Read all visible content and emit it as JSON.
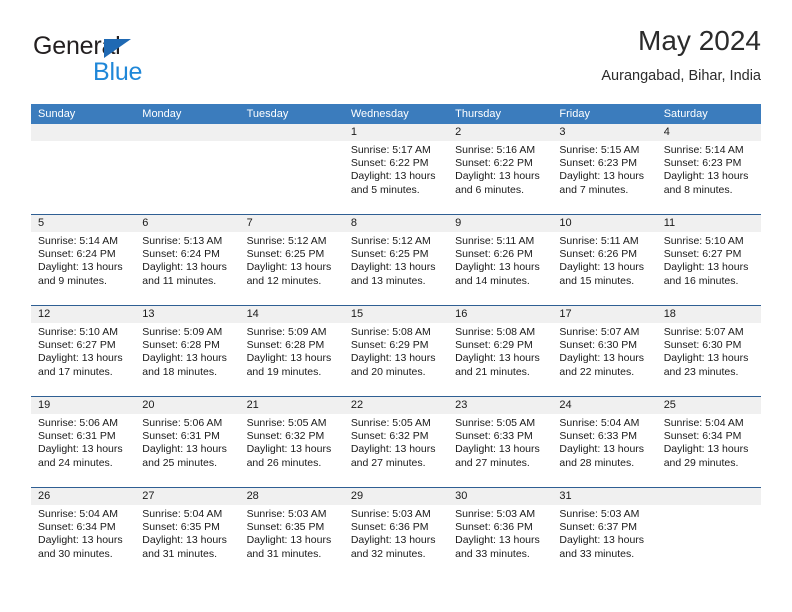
{
  "brand": {
    "line1": "General",
    "line2": "Blue",
    "triangle_color": "#1f69b3",
    "line2_color": "#1f87d8"
  },
  "header": {
    "title": "May 2024",
    "subtitle": "Aurangabad, Bihar, India"
  },
  "theme": {
    "header_bg": "#3b7cbd",
    "header_text": "#ffffff",
    "date_band_bg": "#f0f0f0",
    "week_rule": "#2f5f93"
  },
  "calendar": {
    "day_headers": [
      "Sunday",
      "Monday",
      "Tuesday",
      "Wednesday",
      "Thursday",
      "Friday",
      "Saturday"
    ],
    "weeks": [
      [
        {
          "date": "",
          "sunrise": "",
          "sunset": "",
          "daylight_line1": "",
          "daylight_line2": ""
        },
        {
          "date": "",
          "sunrise": "",
          "sunset": "",
          "daylight_line1": "",
          "daylight_line2": ""
        },
        {
          "date": "",
          "sunrise": "",
          "sunset": "",
          "daylight_line1": "",
          "daylight_line2": ""
        },
        {
          "date": "1",
          "sunrise": "Sunrise: 5:17 AM",
          "sunset": "Sunset: 6:22 PM",
          "daylight_line1": "Daylight: 13 hours",
          "daylight_line2": "and 5 minutes."
        },
        {
          "date": "2",
          "sunrise": "Sunrise: 5:16 AM",
          "sunset": "Sunset: 6:22 PM",
          "daylight_line1": "Daylight: 13 hours",
          "daylight_line2": "and 6 minutes."
        },
        {
          "date": "3",
          "sunrise": "Sunrise: 5:15 AM",
          "sunset": "Sunset: 6:23 PM",
          "daylight_line1": "Daylight: 13 hours",
          "daylight_line2": "and 7 minutes."
        },
        {
          "date": "4",
          "sunrise": "Sunrise: 5:14 AM",
          "sunset": "Sunset: 6:23 PM",
          "daylight_line1": "Daylight: 13 hours",
          "daylight_line2": "and 8 minutes."
        }
      ],
      [
        {
          "date": "5",
          "sunrise": "Sunrise: 5:14 AM",
          "sunset": "Sunset: 6:24 PM",
          "daylight_line1": "Daylight: 13 hours",
          "daylight_line2": "and 9 minutes."
        },
        {
          "date": "6",
          "sunrise": "Sunrise: 5:13 AM",
          "sunset": "Sunset: 6:24 PM",
          "daylight_line1": "Daylight: 13 hours",
          "daylight_line2": "and 11 minutes."
        },
        {
          "date": "7",
          "sunrise": "Sunrise: 5:12 AM",
          "sunset": "Sunset: 6:25 PM",
          "daylight_line1": "Daylight: 13 hours",
          "daylight_line2": "and 12 minutes."
        },
        {
          "date": "8",
          "sunrise": "Sunrise: 5:12 AM",
          "sunset": "Sunset: 6:25 PM",
          "daylight_line1": "Daylight: 13 hours",
          "daylight_line2": "and 13 minutes."
        },
        {
          "date": "9",
          "sunrise": "Sunrise: 5:11 AM",
          "sunset": "Sunset: 6:26 PM",
          "daylight_line1": "Daylight: 13 hours",
          "daylight_line2": "and 14 minutes."
        },
        {
          "date": "10",
          "sunrise": "Sunrise: 5:11 AM",
          "sunset": "Sunset: 6:26 PM",
          "daylight_line1": "Daylight: 13 hours",
          "daylight_line2": "and 15 minutes."
        },
        {
          "date": "11",
          "sunrise": "Sunrise: 5:10 AM",
          "sunset": "Sunset: 6:27 PM",
          "daylight_line1": "Daylight: 13 hours",
          "daylight_line2": "and 16 minutes."
        }
      ],
      [
        {
          "date": "12",
          "sunrise": "Sunrise: 5:10 AM",
          "sunset": "Sunset: 6:27 PM",
          "daylight_line1": "Daylight: 13 hours",
          "daylight_line2": "and 17 minutes."
        },
        {
          "date": "13",
          "sunrise": "Sunrise: 5:09 AM",
          "sunset": "Sunset: 6:28 PM",
          "daylight_line1": "Daylight: 13 hours",
          "daylight_line2": "and 18 minutes."
        },
        {
          "date": "14",
          "sunrise": "Sunrise: 5:09 AM",
          "sunset": "Sunset: 6:28 PM",
          "daylight_line1": "Daylight: 13 hours",
          "daylight_line2": "and 19 minutes."
        },
        {
          "date": "15",
          "sunrise": "Sunrise: 5:08 AM",
          "sunset": "Sunset: 6:29 PM",
          "daylight_line1": "Daylight: 13 hours",
          "daylight_line2": "and 20 minutes."
        },
        {
          "date": "16",
          "sunrise": "Sunrise: 5:08 AM",
          "sunset": "Sunset: 6:29 PM",
          "daylight_line1": "Daylight: 13 hours",
          "daylight_line2": "and 21 minutes."
        },
        {
          "date": "17",
          "sunrise": "Sunrise: 5:07 AM",
          "sunset": "Sunset: 6:30 PM",
          "daylight_line1": "Daylight: 13 hours",
          "daylight_line2": "and 22 minutes."
        },
        {
          "date": "18",
          "sunrise": "Sunrise: 5:07 AM",
          "sunset": "Sunset: 6:30 PM",
          "daylight_line1": "Daylight: 13 hours",
          "daylight_line2": "and 23 minutes."
        }
      ],
      [
        {
          "date": "19",
          "sunrise": "Sunrise: 5:06 AM",
          "sunset": "Sunset: 6:31 PM",
          "daylight_line1": "Daylight: 13 hours",
          "daylight_line2": "and 24 minutes."
        },
        {
          "date": "20",
          "sunrise": "Sunrise: 5:06 AM",
          "sunset": "Sunset: 6:31 PM",
          "daylight_line1": "Daylight: 13 hours",
          "daylight_line2": "and 25 minutes."
        },
        {
          "date": "21",
          "sunrise": "Sunrise: 5:05 AM",
          "sunset": "Sunset: 6:32 PM",
          "daylight_line1": "Daylight: 13 hours",
          "daylight_line2": "and 26 minutes."
        },
        {
          "date": "22",
          "sunrise": "Sunrise: 5:05 AM",
          "sunset": "Sunset: 6:32 PM",
          "daylight_line1": "Daylight: 13 hours",
          "daylight_line2": "and 27 minutes."
        },
        {
          "date": "23",
          "sunrise": "Sunrise: 5:05 AM",
          "sunset": "Sunset: 6:33 PM",
          "daylight_line1": "Daylight: 13 hours",
          "daylight_line2": "and 27 minutes."
        },
        {
          "date": "24",
          "sunrise": "Sunrise: 5:04 AM",
          "sunset": "Sunset: 6:33 PM",
          "daylight_line1": "Daylight: 13 hours",
          "daylight_line2": "and 28 minutes."
        },
        {
          "date": "25",
          "sunrise": "Sunrise: 5:04 AM",
          "sunset": "Sunset: 6:34 PM",
          "daylight_line1": "Daylight: 13 hours",
          "daylight_line2": "and 29 minutes."
        }
      ],
      [
        {
          "date": "26",
          "sunrise": "Sunrise: 5:04 AM",
          "sunset": "Sunset: 6:34 PM",
          "daylight_line1": "Daylight: 13 hours",
          "daylight_line2": "and 30 minutes."
        },
        {
          "date": "27",
          "sunrise": "Sunrise: 5:04 AM",
          "sunset": "Sunset: 6:35 PM",
          "daylight_line1": "Daylight: 13 hours",
          "daylight_line2": "and 31 minutes."
        },
        {
          "date": "28",
          "sunrise": "Sunrise: 5:03 AM",
          "sunset": "Sunset: 6:35 PM",
          "daylight_line1": "Daylight: 13 hours",
          "daylight_line2": "and 31 minutes."
        },
        {
          "date": "29",
          "sunrise": "Sunrise: 5:03 AM",
          "sunset": "Sunset: 6:36 PM",
          "daylight_line1": "Daylight: 13 hours",
          "daylight_line2": "and 32 minutes."
        },
        {
          "date": "30",
          "sunrise": "Sunrise: 5:03 AM",
          "sunset": "Sunset: 6:36 PM",
          "daylight_line1": "Daylight: 13 hours",
          "daylight_line2": "and 33 minutes."
        },
        {
          "date": "31",
          "sunrise": "Sunrise: 5:03 AM",
          "sunset": "Sunset: 6:37 PM",
          "daylight_line1": "Daylight: 13 hours",
          "daylight_line2": "and 33 minutes."
        },
        {
          "date": "",
          "sunrise": "",
          "sunset": "",
          "daylight_line1": "",
          "daylight_line2": ""
        }
      ]
    ]
  }
}
